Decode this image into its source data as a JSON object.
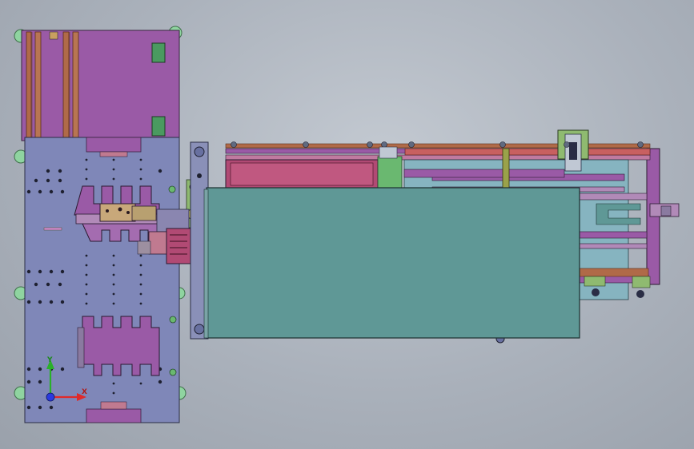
{
  "triad": {
    "y_label": "Y",
    "x_label": "X"
  },
  "colors": {
    "background": "#b3bac3",
    "base_plate": "#7f87b8",
    "magenta_panel": "#9a5aa6",
    "teal_cover": "#5f9896",
    "copper_rail": "#b06a48",
    "green_block": "#5aa860",
    "pink_box": "#b14a74",
    "gray_block": "#9d8fa0",
    "olive_part": "#9aa24a",
    "axis_x": "#e02a2a",
    "axis_y": "#2ab02a",
    "axis_z": "#2a3ae0"
  },
  "icons": {
    "triad": "coordinate-triad-icon"
  }
}
